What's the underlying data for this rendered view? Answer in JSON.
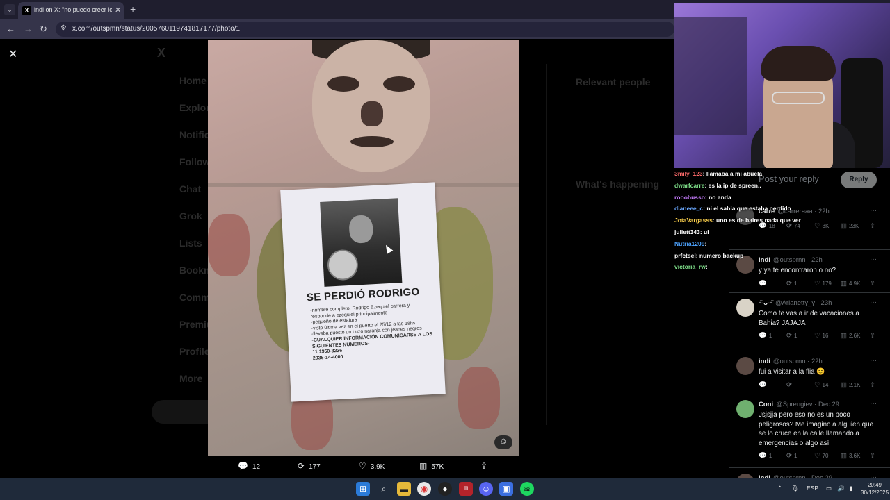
{
  "browser": {
    "tab_title": "indi on X: \"no puedo creer lo q",
    "tab_favicon": "X",
    "url": "x.com/outspmn/status/2005760119741817177/photo/1"
  },
  "icons": {
    "tab_menu": "chevron-down-icon",
    "tab_close": "close-icon",
    "new_tab": "plus-icon",
    "back": "arrow-left-icon",
    "forward": "arrow-right-icon",
    "reload": "reload-icon",
    "site_info": "tune-icon",
    "lightbox_close": "close-icon"
  },
  "glyphs": {
    "tab_menu": "⌄",
    "tab_close": "✕",
    "new_tab": "+",
    "back": "←",
    "forward": "→",
    "reload": "↻",
    "site_info": "⚙",
    "close": "✕",
    "reply": "💬",
    "repost": "⟳",
    "like": "♡",
    "views": "▥",
    "share": "⇪",
    "more": "···",
    "badge": "⌬"
  },
  "background_nav": [
    "Home",
    "Explore",
    "Notifications",
    "Follow",
    "Chat",
    "Grok",
    "Lists",
    "Bookmarks",
    "Communities",
    "Premium",
    "Profile",
    "More"
  ],
  "background_side": {
    "relevant_people": "Relevant people",
    "whats_happening": "What's happening"
  },
  "poster": {
    "title": "SE PERDIÓ RODRIGO",
    "lines": [
      "-nombre completo: Rodrigo Ezequiel carrera y",
      "responde a ezequiel principalmente",
      "-pequeño de estatura",
      "-visto última vez en el puerto el 25/12 a las 18hs",
      "-llevaba puesto un buzo naranja con jeanes negros"
    ],
    "bold_lines": [
      "-CUALQUIER INFORMACIÓN COMUNICARSE A LOS",
      "SIGUIENTES NÚMEROS-",
      "11 1950-3236",
      "2936-14-4000"
    ]
  },
  "photo_actions": {
    "replies": "12",
    "reposts": "177",
    "likes": "3.9K",
    "views": "57K"
  },
  "chat": [
    {
      "user": "3mily_123",
      "color": "#ff6b6b",
      "msg": ": llamaba a mi abuela"
    },
    {
      "user": "dwarfcarre",
      "color": "#7fe08a",
      "msg": ": es la ip de spreen.."
    },
    {
      "user": "rooobusso",
      "color": "#c77dff",
      "msg": ": no anda"
    },
    {
      "user": "dianeee_c",
      "color": "#6aa8ff",
      "msg": ": ni el sabia que estaba perdido"
    },
    {
      "user": "JotaVargasss",
      "color": "#ffd34d",
      "msg": ": uno es de baires nada que ver"
    },
    {
      "user": "juliett343",
      "color": "#ffffff",
      "msg": ": ui"
    },
    {
      "user": "Nutria1209",
      "color": "#4da3ff",
      "msg": ":"
    },
    {
      "user": "prfctsel",
      "color": "#ffffff",
      "msg": ": numero backup"
    },
    {
      "user": "victoria_rw",
      "color": "#7fe08a",
      "msg": ":"
    }
  ],
  "reply_box": {
    "placeholder": "Post your reply",
    "button": "Reply"
  },
  "tweets": [
    {
      "name": "carre",
      "meta": "@carreraaa · 22h",
      "text": "",
      "replies": "18",
      "reposts": "74",
      "likes": "3K",
      "views": "23K"
    },
    {
      "name": "indi",
      "meta": "@outsprnn · 22h",
      "text": "y ya te encontraron o no?",
      "replies": "",
      "reposts": "1",
      "likes": "179",
      "views": "4.9K"
    },
    {
      "name": "ᵕ̈-ᴗ-ᵕ̈",
      "meta": "@Arlanetty_y · 23h",
      "text": "Como te vas a ir de vacaciones a Bahia? JAJAJA",
      "replies": "1",
      "reposts": "1",
      "likes": "16",
      "views": "2.6K"
    },
    {
      "name": "indi",
      "meta": "@outsprnn · 22h",
      "text": "fui a visitar a la flia 😊",
      "replies": "",
      "reposts": "",
      "likes": "14",
      "views": "2.1K"
    },
    {
      "name": "Coni",
      "meta": "@Sprengiev · Dec 29",
      "text": "Jsjsjja pero eso no es un poco peligrosos? Me imagino a alguien que se lo cruce en la calle llamando a emergencias o algo así",
      "replies": "1",
      "reposts": "1",
      "likes": "70",
      "views": "3.6K"
    },
    {
      "name": "indi",
      "meta": "@outsprnn · Dec 29",
      "text": "",
      "replies": "",
      "reposts": "",
      "likes": "",
      "views": ""
    }
  ],
  "taskbar": {
    "lang": "ESP",
    "time": "20:49",
    "date": "30/12/2025",
    "icons": [
      "windows-start-icon",
      "search-icon",
      "file-explorer-icon",
      "chrome-icon",
      "obs-icon",
      "netflix-app-icon",
      "discord-icon",
      "app-icon",
      "spotify-icon"
    ]
  },
  "colors": {
    "x_background": "#000000",
    "browser_chrome": "#35344a",
    "taskbar": "#1f2a3a",
    "accent_twitter_text": "#e7e9ea",
    "muted_text": "#71767b"
  }
}
